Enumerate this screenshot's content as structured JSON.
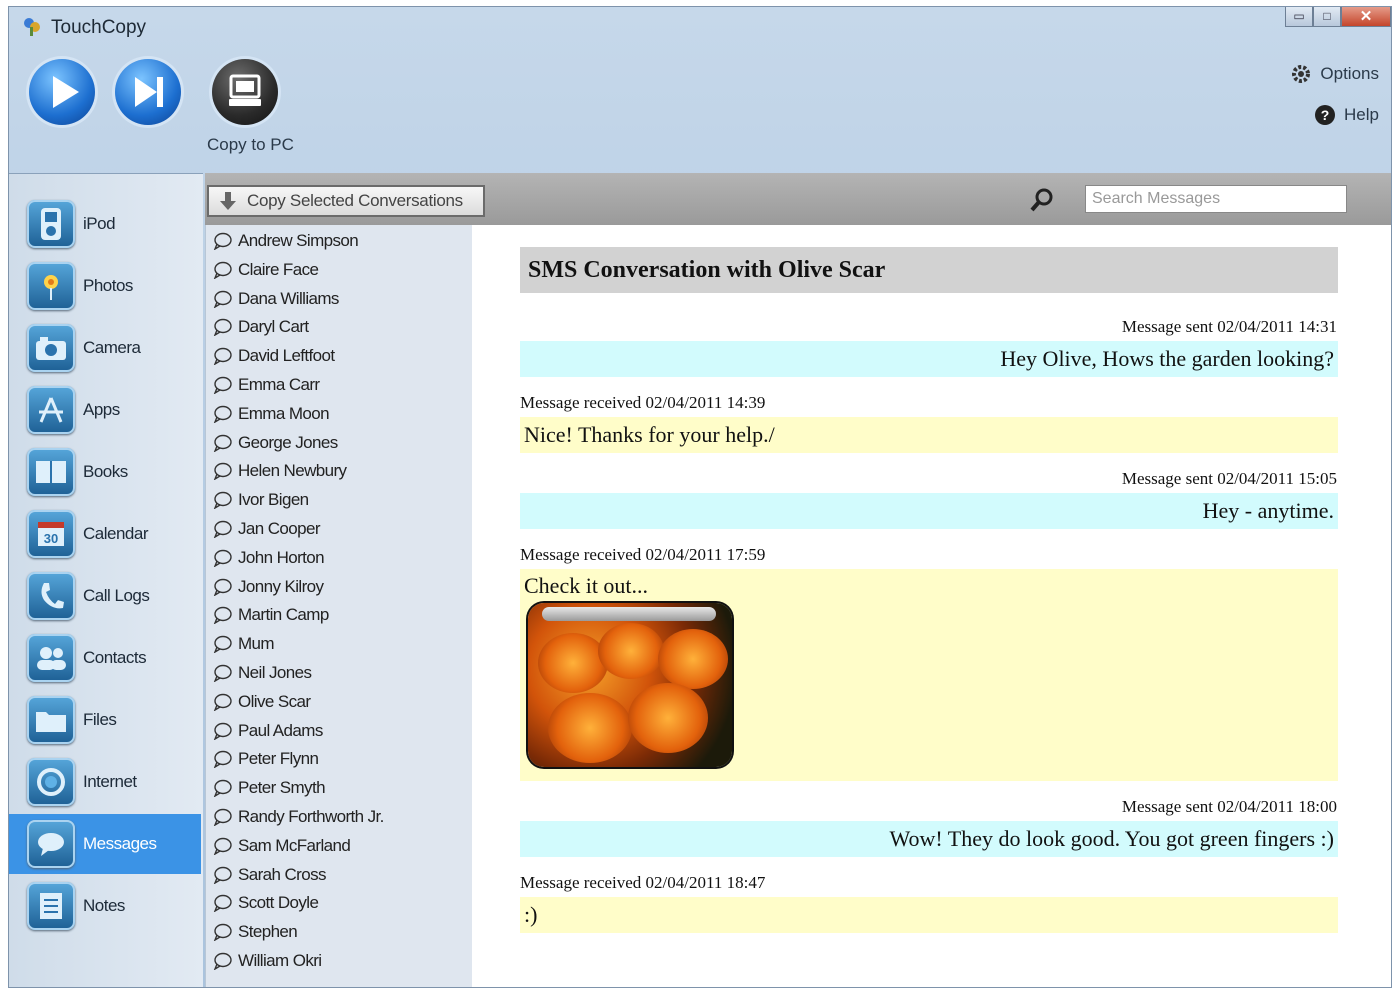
{
  "window": {
    "title": "TouchCopy",
    "buttons": {
      "minimize": "▭",
      "maximize": "□",
      "close": "✕"
    }
  },
  "toolbar": {
    "play_icon": "play-icon",
    "next_icon": "next-track-icon",
    "copy_to_pc_label": "Copy to PC",
    "options_label": "Options",
    "help_label": "Help"
  },
  "sidebar": {
    "items": [
      {
        "label": "iPod",
        "icon": "ipod-icon"
      },
      {
        "label": "Photos",
        "icon": "photos-icon"
      },
      {
        "label": "Camera",
        "icon": "camera-icon"
      },
      {
        "label": "Apps",
        "icon": "apps-icon"
      },
      {
        "label": "Books",
        "icon": "books-icon"
      },
      {
        "label": "Calendar",
        "icon": "calendar-icon"
      },
      {
        "label": "Call Logs",
        "icon": "phone-icon"
      },
      {
        "label": "Contacts",
        "icon": "contacts-icon"
      },
      {
        "label": "Files",
        "icon": "folder-icon"
      },
      {
        "label": "Internet",
        "icon": "internet-icon"
      },
      {
        "label": "Messages",
        "icon": "message-icon"
      },
      {
        "label": "Notes",
        "icon": "notes-icon"
      }
    ],
    "active": "Messages",
    "calendar_day": "30"
  },
  "contacts_panel": {
    "copy_selected_label": "Copy Selected Conversations",
    "contacts": [
      "Andrew Simpson",
      "Claire Face",
      "Dana Williams",
      "Daryl Cart",
      "David Leftfoot",
      "Emma Carr",
      "Emma Moon",
      "George Jones",
      "Helen Newbury",
      "Ivor Bigen",
      "Jan Cooper",
      "John Horton",
      "Jonny Kilroy",
      "Martin Camp",
      "Mum",
      "Neil Jones",
      "Olive Scar",
      "Paul Adams",
      "Peter Flynn",
      "Peter Smyth",
      "Randy Forthworth Jr.",
      "Sam McFarland",
      "Sarah Cross",
      "Scott Doyle",
      "Stephen",
      "William Okri"
    ]
  },
  "search": {
    "placeholder": "Search Messages"
  },
  "conversation": {
    "title": "SMS Conversation with Olive Scar",
    "messages": [
      {
        "direction": "sent",
        "meta": "Message sent 02/04/2011 14:31",
        "text": "Hey Olive, Hows the garden looking?"
      },
      {
        "direction": "received",
        "meta": "Message received 02/04/2011 14:39",
        "text": "Nice! Thanks for your help./"
      },
      {
        "direction": "sent",
        "meta": "Message sent 02/04/2011 15:05",
        "text": "Hey - anytime."
      },
      {
        "direction": "received",
        "meta": "Message received 02/04/2011 17:59",
        "text": "Check it out..."
      },
      {
        "direction": "sent",
        "meta": "Message sent 02/04/2011 18:00",
        "text": "Wow! They do look good. You got green fingers :)"
      },
      {
        "direction": "received",
        "meta": "Message received 02/04/2011 18:47",
        "text": ":)"
      }
    ]
  },
  "colors": {
    "active_tab": "#3b93e6",
    "sent_bg": "#d2fbfd",
    "received_bg": "#fffdc9",
    "title_bg": "#d2d2d2"
  }
}
